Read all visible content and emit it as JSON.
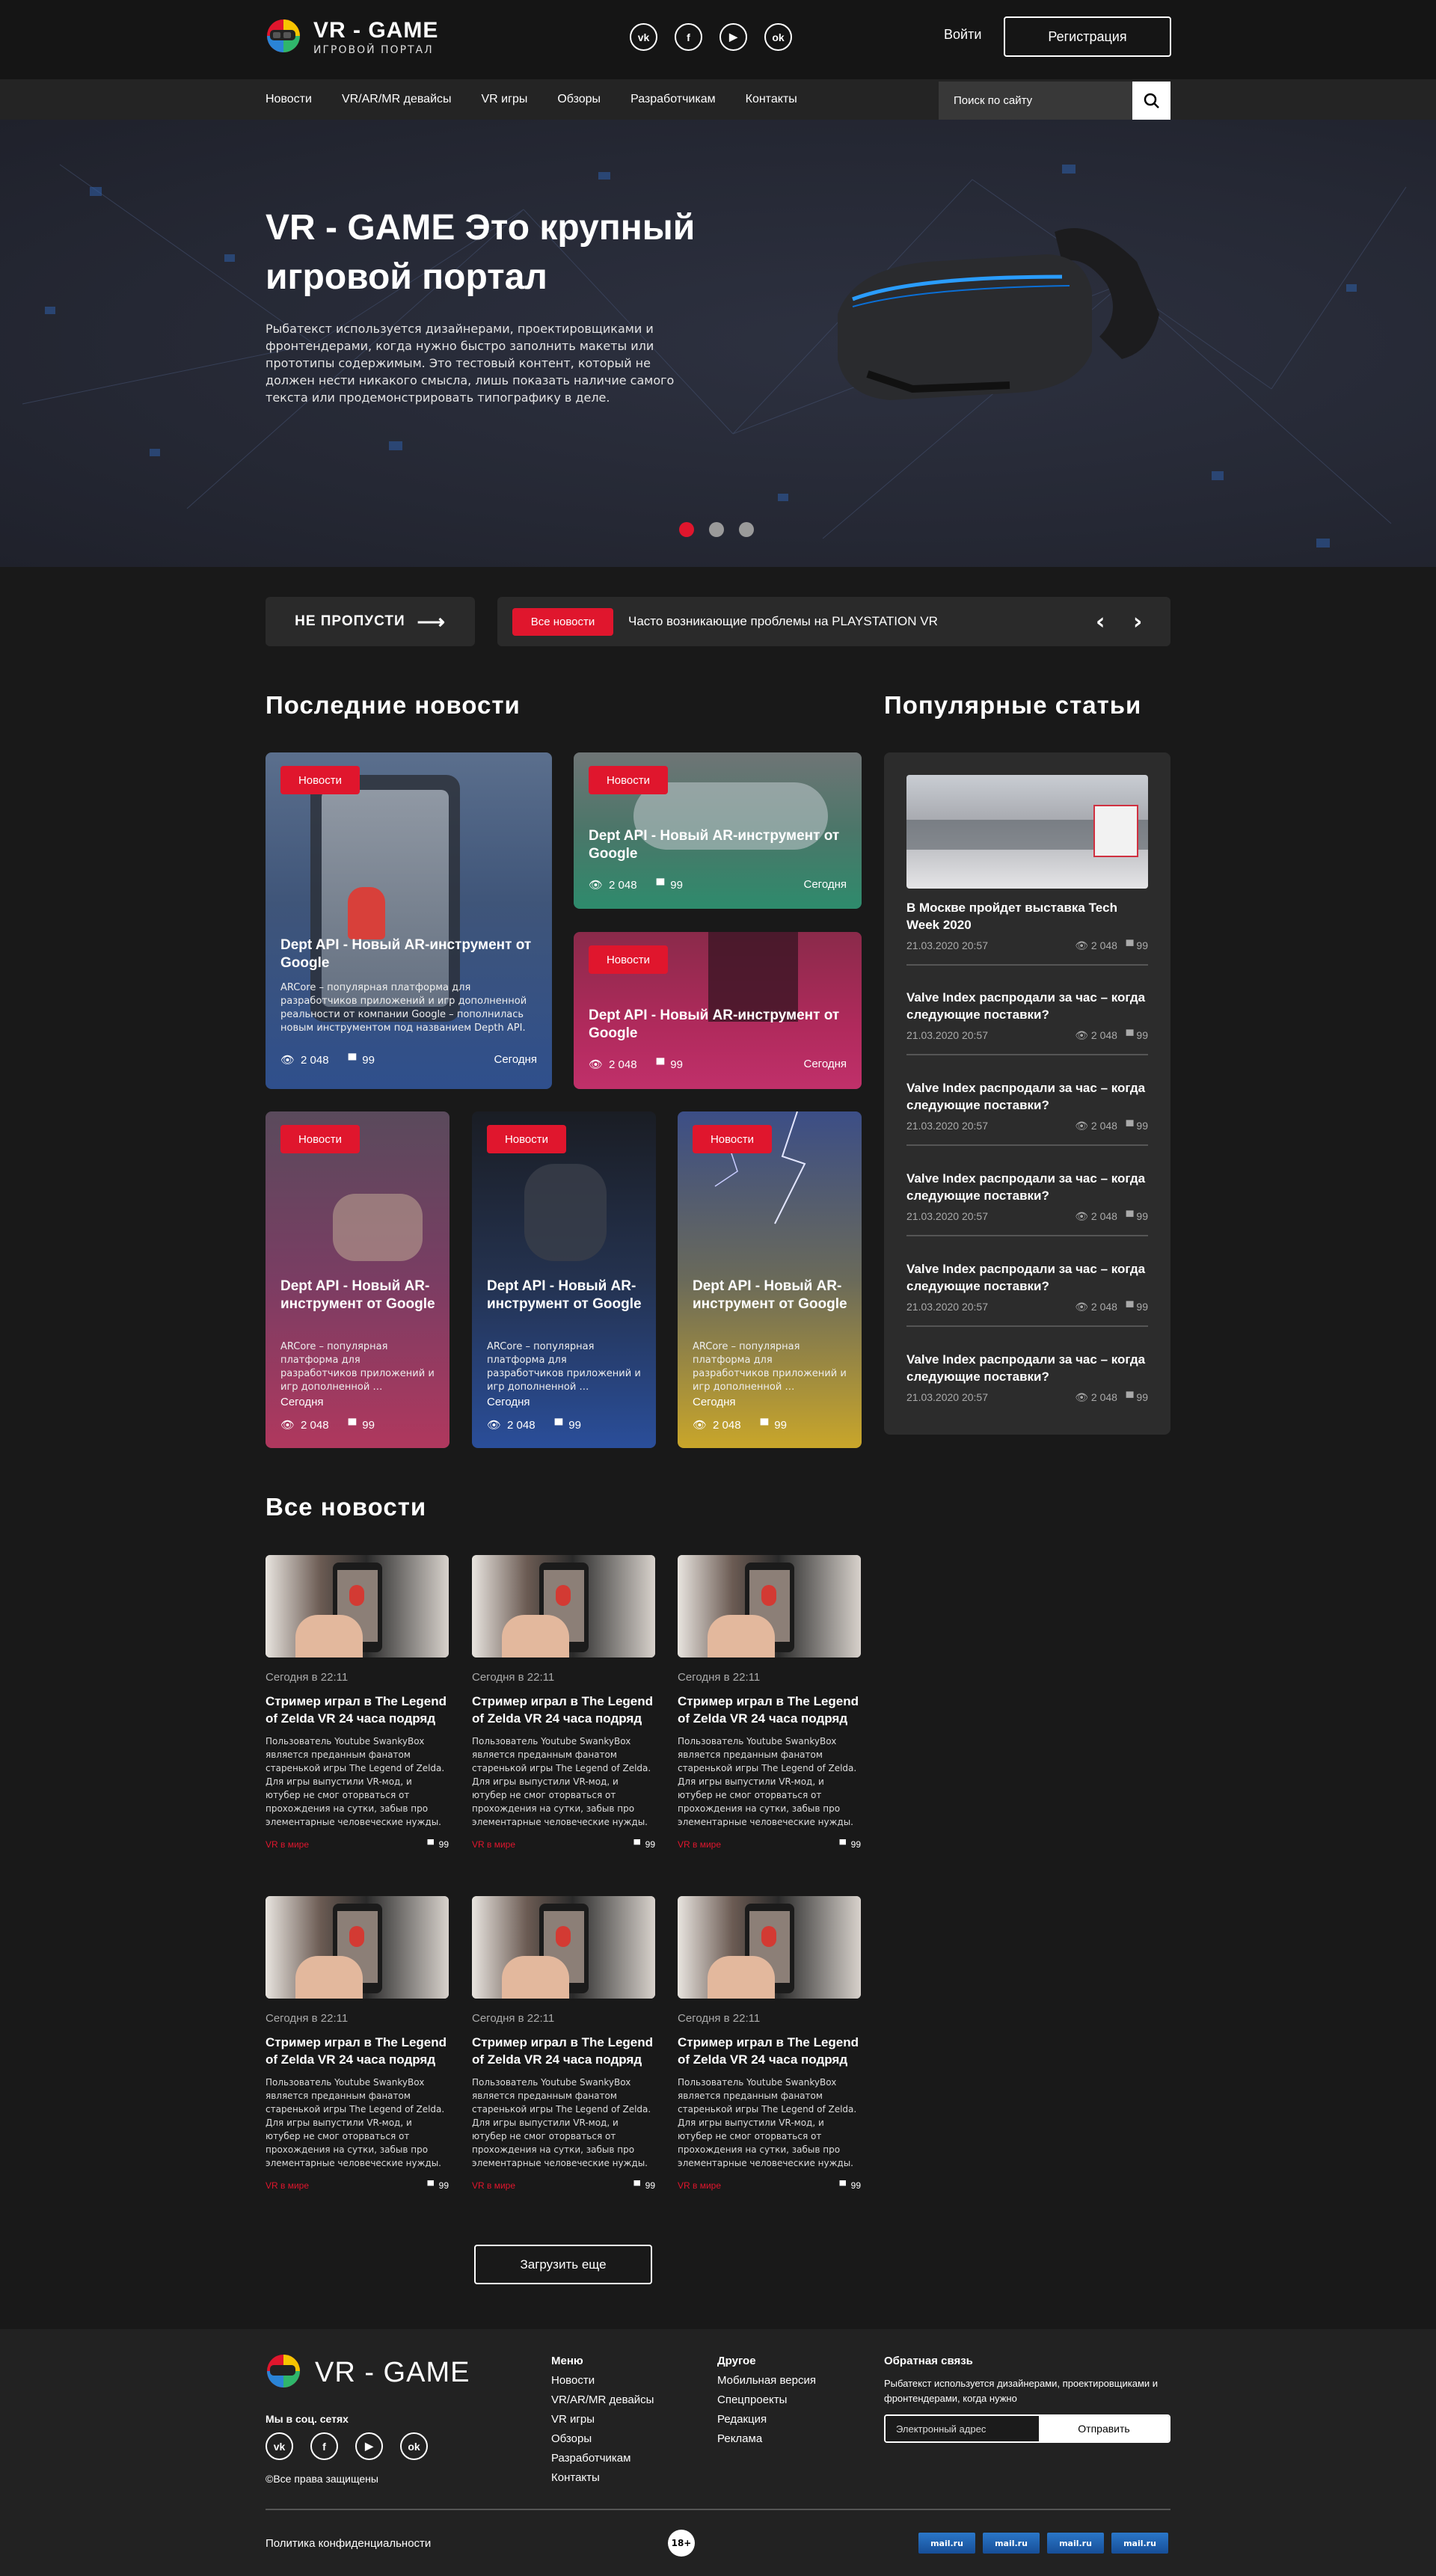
{
  "header": {
    "logo_title": "VR - GAME",
    "logo_subtitle": "ИГРОВОЙ ПОРТАЛ",
    "socials": [
      "vk",
      "f",
      "yt",
      "ok"
    ],
    "login": "Войти",
    "register": "Регистрация"
  },
  "nav": {
    "items": [
      "Новости",
      "VR/AR/MR девайсы",
      "VR игры",
      "Обзоры",
      "Разработчикам",
      "Контакты"
    ],
    "search_placeholder": "Поиск по сайту"
  },
  "hero": {
    "title": "VR - GAME Это крупный игровой портал",
    "text": "Рыбатекст используется дизайнерами, проектировщиками и фронтендерами, когда нужно быстро заполнить макеты или прототипы содержимым. Это тестовый контент, который не должен нести никакого смысла, лишь показать наличие самого текста или продемонстрировать типографику в деле.",
    "slides": 3,
    "active_slide": 1
  },
  "ticker": {
    "miss_label": "НЕ ПРОПУСТИ",
    "badge": "Все новости",
    "text": "Часто возникающие проблемы на PLAYSTATION VR"
  },
  "latest": {
    "heading": "Последние новости",
    "cards": [
      {
        "badge": "Новости",
        "title": "Dept API - Новый AR-инструмент от Google",
        "text": "ARCore – популярная платформа для разработчиков приложений и игр дополненной реальности от компании Google – пополнилась новым инструментом под названием Depth API.",
        "views": "2 048",
        "comments": "99",
        "date": "Сегодня"
      },
      {
        "badge": "Новости",
        "title": "Dept API - Новый AR-инструмент от Google",
        "views": "2 048",
        "comments": "99",
        "date": "Сегодня"
      },
      {
        "badge": "Новости",
        "title": "Dept API - Новый AR-инструмент от Google",
        "views": "2 048",
        "comments": "99",
        "date": "Сегодня"
      },
      {
        "badge": "Новости",
        "title": "Dept API - Новый AR-инструмент от Google",
        "text": "ARCore – популярная платформа для разработчиков приложений и игр дополненной …",
        "views": "2 048",
        "comments": "99",
        "date": "Сегодня"
      },
      {
        "badge": "Новости",
        "title": "Dept API - Новый AR-инструмент от Google",
        "text": "ARCore – популярная платформа для разработчиков приложений и игр дополненной …",
        "views": "2 048",
        "comments": "99",
        "date": "Сегодня"
      },
      {
        "badge": "Новости",
        "title": "Dept API - Новый AR-инструмент от Google",
        "text": "ARCore – популярная платформа для разработчиков приложений и игр дополненной …",
        "views": "2 048",
        "comments": "99",
        "date": "Сегодня"
      }
    ]
  },
  "popular": {
    "heading": "Популярные статьи",
    "items": [
      {
        "title": "В Москве пройдет выставка Tech Week 2020",
        "date": "21.03.2020  20:57",
        "views": "2 048",
        "comments": "99"
      },
      {
        "title": "Valve Index распродали за час – когда следующие поставки?",
        "date": "21.03.2020  20:57",
        "views": "2 048",
        "comments": "99"
      },
      {
        "title": "Valve Index распродали за час – когда следующие поставки?",
        "date": "21.03.2020  20:57",
        "views": "2 048",
        "comments": "99"
      },
      {
        "title": "Valve Index распродали за час – когда следующие поставки?",
        "date": "21.03.2020  20:57",
        "views": "2 048",
        "comments": "99"
      },
      {
        "title": "Valve Index распродали за час – когда следующие поставки?",
        "date": "21.03.2020  20:57",
        "views": "2 048",
        "comments": "99"
      },
      {
        "title": "Valve Index распродали за час – когда следующие поставки?",
        "date": "21.03.2020  20:57",
        "views": "2 048",
        "comments": "99"
      }
    ]
  },
  "all_news": {
    "heading": "Все новости",
    "items": [
      {
        "date": "Сегодня в 22:11",
        "title": "Стример играл в The Legend of Zelda VR 24 часа подряд",
        "text": "Пользователь Youtube SwankyBox является преданным фанатом старенькой игры The Legend of Zelda. Для игры выпустили VR-мод, и ютубер не смог оторваться от прохождения на сутки, забыв про элементарные человеческие нужды.",
        "tag": "VR в мире",
        "comments": "99"
      },
      {
        "date": "Сегодня в 22:11",
        "title": "Стример играл в The Legend of Zelda VR 24 часа подряд",
        "text": "Пользователь Youtube SwankyBox является преданным фанатом старенькой игры The Legend of Zelda. Для игры выпустили VR-мод, и ютубер не смог оторваться от прохождения на сутки, забыв про элементарные человеческие нужды.",
        "tag": "VR в мире",
        "comments": "99"
      },
      {
        "date": "Сегодня в 22:11",
        "title": "Стример играл в The Legend of Zelda VR 24 часа подряд",
        "text": "Пользователь Youtube SwankyBox является преданным фанатом старенькой игры The Legend of Zelda. Для игры выпустили VR-мод, и ютубер не смог оторваться от прохождения на сутки, забыв про элементарные человеческие нужды.",
        "tag": "VR в мире",
        "comments": "99"
      },
      {
        "date": "Сегодня в 22:11",
        "title": "Стример играл в The Legend of Zelda VR 24 часа подряд",
        "text": "Пользователь Youtube SwankyBox является преданным фанатом старенькой игры The Legend of Zelda. Для игры выпустили VR-мод, и ютубер не смог оторваться от прохождения на сутки, забыв про элементарные человеческие нужды.",
        "tag": "VR в мире",
        "comments": "99"
      },
      {
        "date": "Сегодня в 22:11",
        "title": "Стример играл в The Legend of Zelda VR 24 часа подряд",
        "text": "Пользователь Youtube SwankyBox является преданным фанатом старенькой игры The Legend of Zelda. Для игры выпустили VR-мод, и ютубер не смог оторваться от прохождения на сутки, забыв про элементарные человеческие нужды.",
        "tag": "VR в мире",
        "comments": "99"
      },
      {
        "date": "Сегодня в 22:11",
        "title": "Стример играл в The Legend of Zelda VR 24 часа подряд",
        "text": "Пользователь Youtube SwankyBox является преданным фанатом старенькой игры The Legend of Zelda. Для игры выпустили VR-мод, и ютубер не смог оторваться от прохождения на сутки, забыв про элементарные человеческие нужды.",
        "tag": "VR в мире",
        "comments": "99"
      }
    ],
    "load_more": "Загрузить еще"
  },
  "footer": {
    "logo_title": "VR - GAME",
    "social_label": "Мы в соц. сетях",
    "copyright": "©Все права защищены",
    "menu_title": "Меню",
    "menu": [
      "Новости",
      "VR/AR/MR девайсы",
      "VR игры",
      "Обзоры",
      "Разработчикам",
      "Контакты"
    ],
    "other_title": "Другое",
    "other": [
      "Мобильная версия",
      "Спецпроекты",
      "Редакция",
      "Реклама"
    ],
    "feedback_title": "Обратная связь",
    "feedback_text": "Рыбатекст используется дизайнерами, проектировщиками и фронтендерами, когда нужно",
    "email_placeholder": "Электронный адрес",
    "send": "Отправить",
    "privacy": "Политика конфиденциальности",
    "age": "18+",
    "counters": [
      "mail.ru",
      "mail.ru",
      "mail.ru",
      "mail.ru"
    ]
  },
  "colors": {
    "accent": "#e0162d",
    "bg": "#191919",
    "panel": "#2c2c2c"
  }
}
